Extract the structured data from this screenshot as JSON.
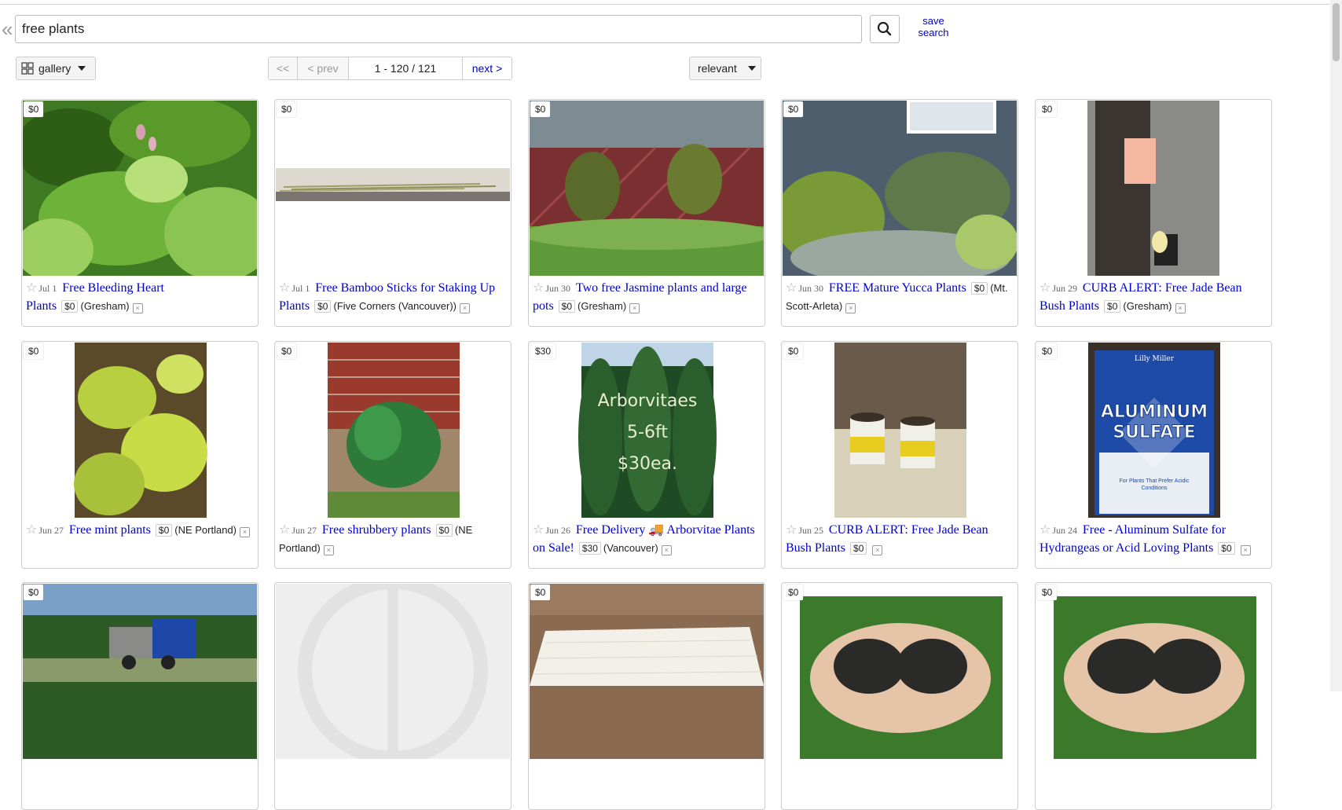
{
  "search": {
    "value": "free plants",
    "back_glyph": "«",
    "save_label_1": "save",
    "save_label_2": "search"
  },
  "toolbar": {
    "view_label": "gallery",
    "pager": {
      "first": "<<",
      "prev": "< prev",
      "range": "1 - 120 / 121",
      "next": "next >"
    },
    "sort_label": "relevant"
  },
  "colors": {
    "link": "#0000cc",
    "border": "#cccccc"
  },
  "listings": [
    {
      "price_tag": "$0",
      "date": "Jul 1",
      "title": "Free Bleeding Heart Plants",
      "price": "$0",
      "hood": "(Gresham)",
      "photo": "green bleeding heart foliage"
    },
    {
      "price_tag": "$0",
      "date": "Jul 1",
      "title": "Free Bamboo Sticks for Staking Up Plants",
      "price": "$0",
      "hood": "(Five Corners (Vancouver))",
      "photo": "bamboo sticks on pavement"
    },
    {
      "price_tag": "$0",
      "date": "Jun 30",
      "title": "Two free Jasmine plants and large pots",
      "price": "$0",
      "hood": "(Gresham)",
      "photo": "jasmine pots by fence"
    },
    {
      "price_tag": "$0",
      "date": "Jun 30",
      "title": "FREE Mature Yucca Plants",
      "price": "$0",
      "hood": "(Mt. Scott-Arleta)",
      "photo": "yucca plants by house"
    },
    {
      "price_tag": "$0",
      "date": "Jun 29",
      "title": "CURB ALERT: Free Jade Bean Bush Plants",
      "price": "$0",
      "hood": "(Gresham)",
      "photo": "free plants sign on tree"
    },
    {
      "price_tag": "$0",
      "date": "Jun 27",
      "title": "Free mint plants",
      "price": "$0",
      "hood": "(NE Portland)",
      "photo": "mint plants"
    },
    {
      "price_tag": "$0",
      "date": "Jun 27",
      "title": "Free shrubbery plants",
      "price": "$0",
      "hood": "(NE Portland)",
      "photo": "shrub by brick wall"
    },
    {
      "price_tag": "$30",
      "date": "Jun 26",
      "title": "Free Delivery 🚚 Arborvitae Plants on Sale!",
      "price": "$30",
      "hood": "(Vancouver)",
      "photo": "arborvitae trees",
      "overlay_1": "Arborvitaes",
      "overlay_2": "5-6ft",
      "overlay_3": "$30ea."
    },
    {
      "price_tag": "$0",
      "date": "Jun 25",
      "title": "CURB ALERT: Free Jade Bean Bush Plants",
      "price": "$0",
      "hood": "",
      "photo": "plants in cups"
    },
    {
      "price_tag": "$0",
      "date": "Jun 24",
      "title": "Free - Aluminum Sulfate for Hydrangeas or Acid Loving Plants",
      "price": "$0",
      "hood": "",
      "photo": "aluminum sulfate bag",
      "bag_1": "Lilly Miller",
      "bag_2": "ALUMINUM",
      "bag_3": "SULFATE",
      "bag_4": "For Plants That Prefer Acidic Conditions"
    },
    {
      "price_tag": "$0",
      "photo": "dump truck"
    },
    {
      "price_tag": "",
      "photo": "no image placeholder"
    },
    {
      "price_tag": "$0",
      "photo": "mattress"
    },
    {
      "price_tag": "$0",
      "photo": "hands holding soil"
    },
    {
      "price_tag": "$0",
      "photo": "hands holding soil"
    }
  ]
}
